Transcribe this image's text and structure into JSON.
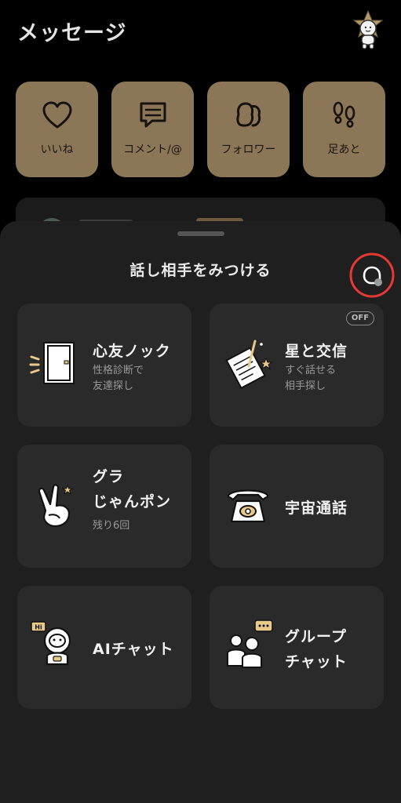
{
  "header": {
    "title": "メッセージ",
    "avatar_icon": "star-character-icon"
  },
  "tiles": [
    {
      "label": "いいね",
      "icon": "heart-icon"
    },
    {
      "label": "コメント/@",
      "icon": "comment-icon"
    },
    {
      "label": "フォロワー",
      "icon": "followers-icon"
    },
    {
      "label": "足あと",
      "icon": "footprints-icon"
    }
  ],
  "sheet": {
    "title": "話し相手をみつける",
    "settings_icon": "settings-toggle-icon"
  },
  "cards": {
    "shinyuu": {
      "title": "心友ノック",
      "sub1": "性格診断で",
      "sub2": "友達探し"
    },
    "hoshi": {
      "title": "星と交信",
      "sub1": "すぐ話せる",
      "sub2": "相手探し",
      "badge": "OFF"
    },
    "janken": {
      "title1": "グラ",
      "title2": "じゃんポン",
      "sub1": "残り6回"
    },
    "uchuu": {
      "title": "宇宙通話"
    },
    "ai": {
      "title": "AIチャット",
      "bubble": "Hi"
    },
    "group": {
      "title1": "グループ",
      "title2": "チャット"
    }
  },
  "colors": {
    "background": "#000000",
    "tile": "#8b7758",
    "sheet": "#1f1f1f",
    "card": "#2a2a2a",
    "accent_gold": "#e8c98a",
    "highlight_ring": "#e53935"
  }
}
